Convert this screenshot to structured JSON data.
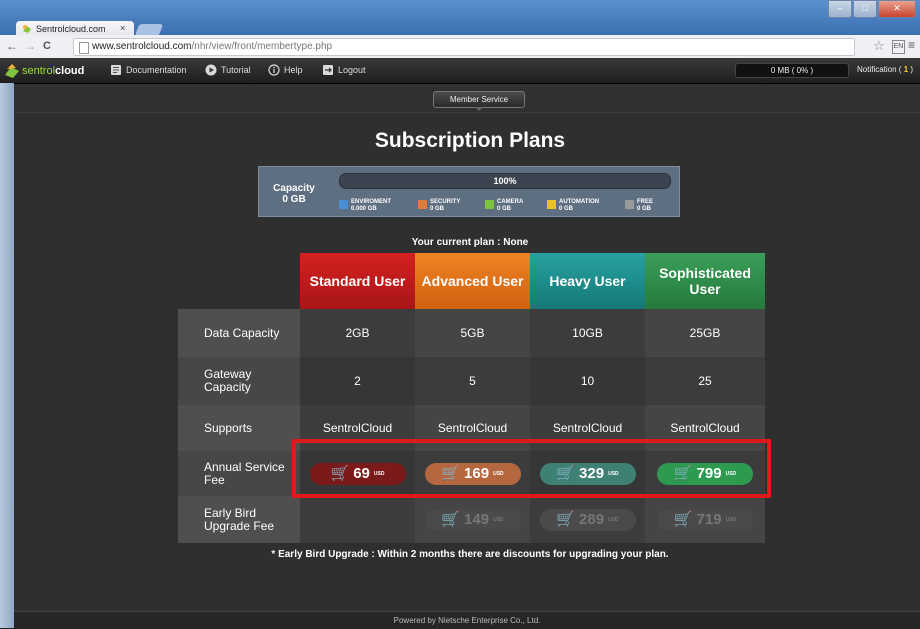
{
  "browser": {
    "tab_title": "Sentrolcloud.com",
    "tab_close": "×",
    "url_host": "www.sentrolcloud.com",
    "url_path": "/nhr/view/front/membertype.php",
    "back": "←",
    "forward": "→",
    "reload": "C",
    "star": "☆",
    "menu": "≡",
    "ext_label": "EN"
  },
  "appbar": {
    "logo_prefix": "sentrol",
    "logo_bold": "cloud",
    "nav": [
      {
        "label": "Documentation",
        "icon": "document-icon"
      },
      {
        "label": "Tutorial",
        "icon": "play-icon"
      },
      {
        "label": "Help",
        "icon": "info-icon"
      },
      {
        "label": "Logout",
        "icon": "logout-icon"
      }
    ],
    "storage_meter": "0 MB ( 0% )",
    "notification_label": "Notification (",
    "notification_count": "1",
    "notification_close": ")"
  },
  "strip": {
    "service_tab": "Member Service"
  },
  "page": {
    "title": "Subscription Plans",
    "capacity_label": "Capacity",
    "capacity_value": "0 GB",
    "capacity_percent": "100%",
    "legend": [
      {
        "label": "ENVIROMENT",
        "value": "0.000 GB",
        "color": "#4a8fd6"
      },
      {
        "label": "SECURITY",
        "value": "0 GB",
        "color": "#e8773a"
      },
      {
        "label": "CAMERA",
        "value": "0 GB",
        "color": "#7ec241"
      },
      {
        "label": "AUTOMATION",
        "value": "0 GB",
        "color": "#e9c322"
      },
      {
        "label": "FREE",
        "value": "0 GB",
        "color": "#9a9a9a"
      }
    ],
    "current_plan": "Your current plan : None",
    "note": "* Early Bird Upgrade : Within 2 months there are discounts for upgrading your plan."
  },
  "plans": [
    {
      "name": "Standard User",
      "color": "#c41f1f",
      "data": "2GB",
      "gateway": "2",
      "supports": "SentrolCloud",
      "fee": "69",
      "upgrade": ""
    },
    {
      "name": "Advanced User",
      "color": "#e2711a",
      "data": "5GB",
      "gateway": "5",
      "supports": "SentrolCloud",
      "fee": "169",
      "upgrade": "149"
    },
    {
      "name": "Heavy User",
      "color": "#1c8f8f",
      "data": "10GB",
      "gateway": "10",
      "supports": "SentrolCloud",
      "fee": "329",
      "upgrade": "289"
    },
    {
      "name": "Sophisticated User",
      "color": "#2f8f4a",
      "data": "25GB",
      "gateway": "25",
      "supports": "SentrolCloud",
      "fee": "799",
      "upgrade": "719"
    }
  ],
  "row_labels": {
    "data": "Data Capacity",
    "gateway": "Gateway Capacity",
    "supports": "Supports",
    "fee": "Annual Service Fee",
    "upgrade": "Early Bird Upgrade Fee"
  },
  "currency": "USD",
  "cart_glyph": "🛒",
  "fee_pill_colors": [
    "#7a1a1a",
    "#b5683f",
    "#3f8074",
    "#2e9a4f"
  ],
  "footer": "Powered by Nietsche Enterprise Co., Ltd."
}
